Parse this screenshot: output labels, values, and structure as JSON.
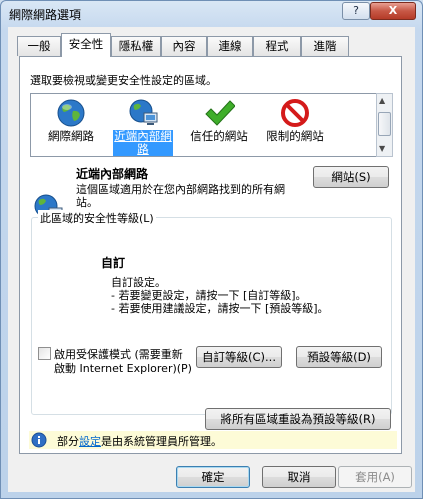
{
  "window": {
    "title": "網際網路選項",
    "help_label": "?",
    "close_label": "X"
  },
  "tabs": [
    "一般",
    "安全性",
    "隱私權",
    "內容",
    "連線",
    "程式",
    "進階"
  ],
  "security": {
    "instruction": "選取要檢視或變更安全性設定的區域。",
    "zones": [
      {
        "label": "網際網路",
        "icon": "globe-icon"
      },
      {
        "label": "近端內部網路",
        "icon": "intranet-icon",
        "selected": true
      },
      {
        "label": "信任的網站",
        "icon": "checkmark-icon"
      },
      {
        "label": "限制的網站",
        "icon": "blocked-icon"
      }
    ],
    "selected_zone": {
      "title": "近端內部網路",
      "description_line1": "這個區域適用於在您內部網路找到的所有網",
      "description_line2": "站。",
      "sites_button": "網站(S)"
    },
    "level_group": {
      "label": "此區域的安全性等級(L)",
      "level_name": "自訂",
      "lines": [
        "自訂設定。",
        "- 若要變更設定，請按一下 [自訂等級]。",
        "- 若要使用建議設定，請按一下 [預設等級]。"
      ],
      "protected_mode_line1": "啟用受保護模式 (需要重新",
      "protected_mode_line2": "啟動 Internet Explorer)(P)",
      "custom_level_button": "自訂等級(C)...",
      "default_level_button": "預設等級(D)"
    },
    "reset_all_button": "將所有區域重設為預設等級(R)",
    "info": {
      "prefix": "部分",
      "link": "設定",
      "suffix": "是由系統管理員所管理。"
    }
  },
  "footer": {
    "ok": "確定",
    "cancel": "取消",
    "apply": "套用(A)"
  },
  "colors": {
    "selection": "#3399ff",
    "info_bar": "#fdfbd7",
    "link": "#0066cc"
  }
}
